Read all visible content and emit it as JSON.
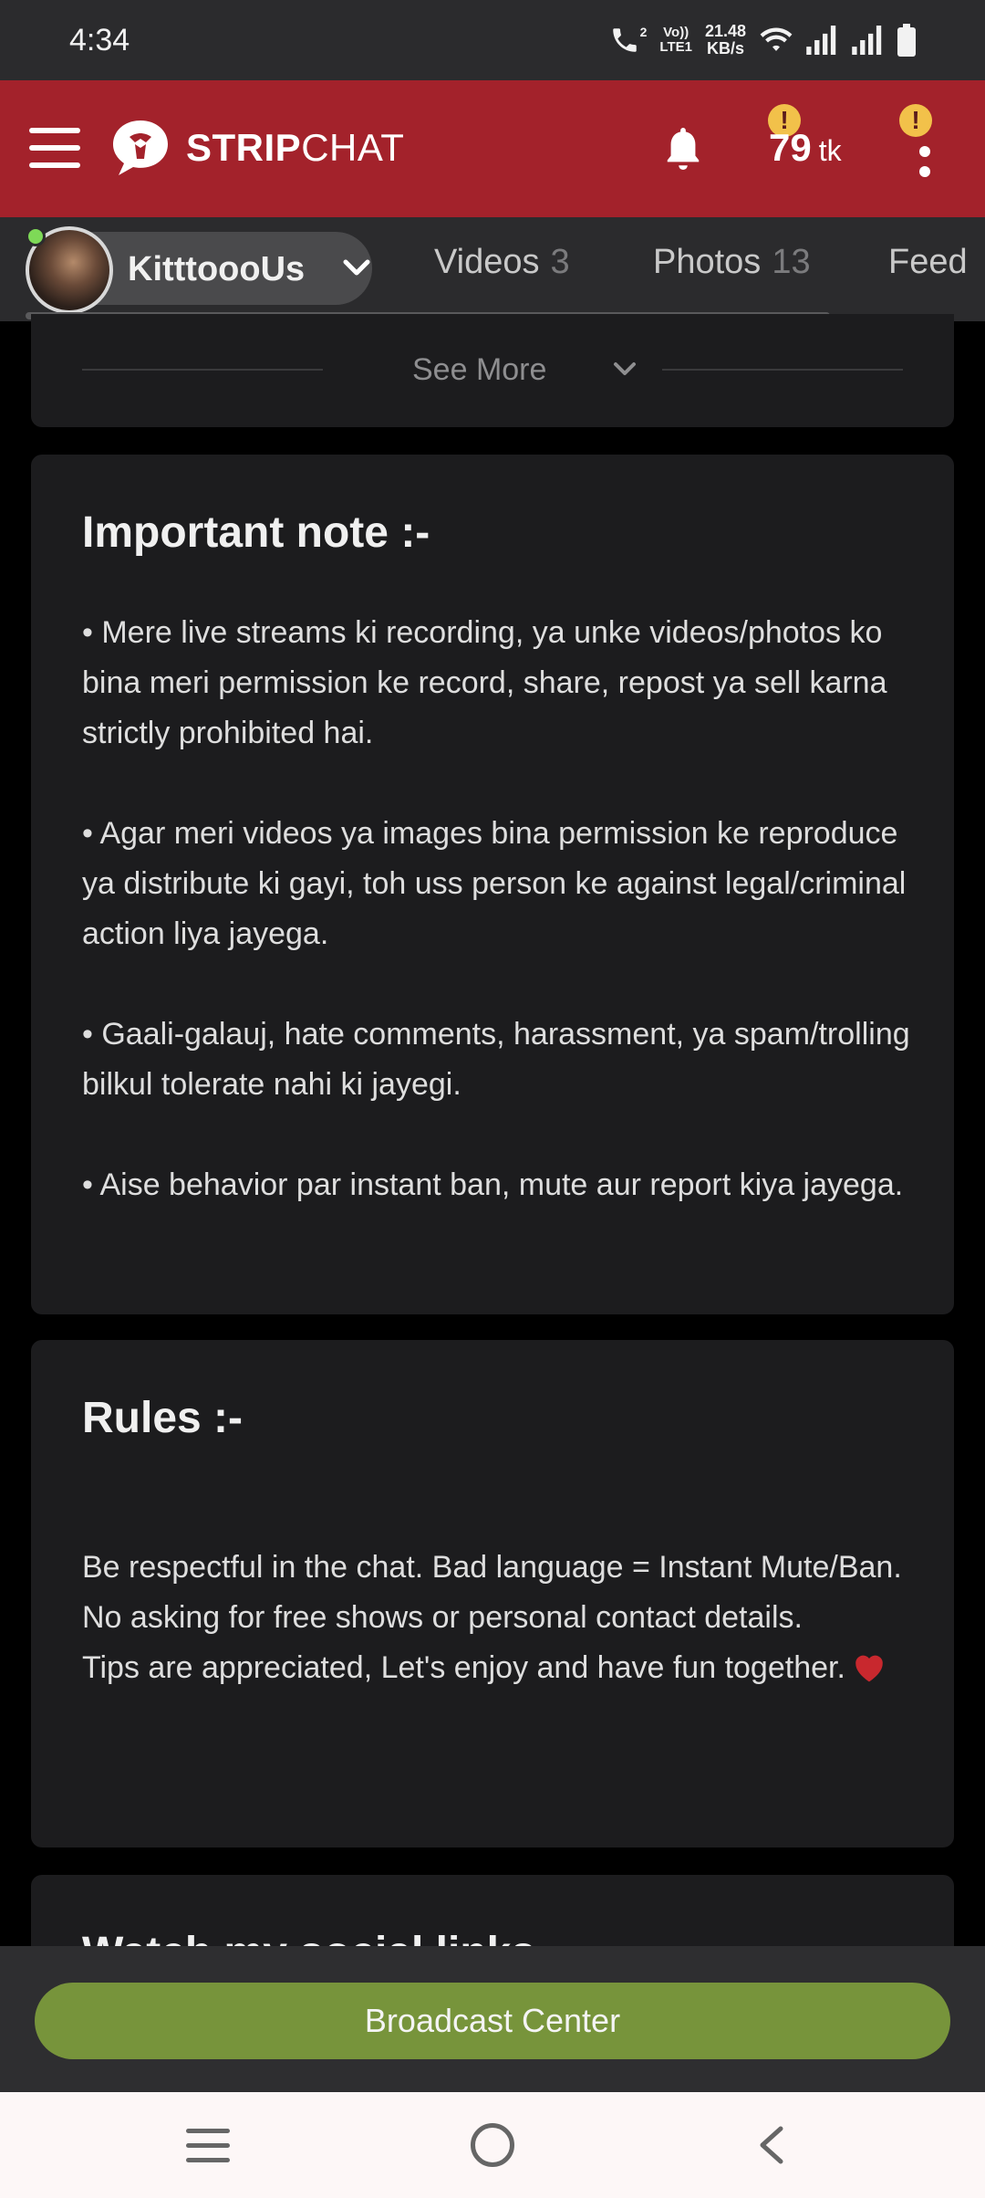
{
  "status_bar": {
    "time": "4:34",
    "call_indicator": "2",
    "network_label_top": "Vo))",
    "network_label_bottom": "LTE1",
    "speed_top": "21.48",
    "speed_bottom": "KB/s"
  },
  "header": {
    "brand_bold": "STRIP",
    "brand_light": "CHAT",
    "token_count": "79",
    "token_unit": "tk",
    "alert_symbol": "!"
  },
  "tabs": {
    "model_name": "KitttoooUs",
    "items": [
      {
        "label": "Videos",
        "count": "3"
      },
      {
        "label": "Photos",
        "count": "13"
      },
      {
        "label": "Feed",
        "count": ""
      }
    ]
  },
  "see_more": {
    "label": "See More"
  },
  "important_note": {
    "title": "Important note :-",
    "paragraphs": [
      "• Mere live streams ki recording, ya unke videos/photos ko bina meri permission ke record, share, repost ya sell karna strictly prohibited hai.",
      "• Agar meri videos ya images bina permission ke reproduce ya distribute ki gayi, toh uss person ke against legal/criminal action liya jayega.",
      "• Gaali-galauj, hate comments, harassment, ya spam/trolling bilkul tolerate nahi ki jayegi.",
      "• Aise behavior par instant ban, mute aur report kiya jayega."
    ]
  },
  "rules": {
    "title": "Rules :-",
    "lines": [
      "Be respectful in the chat. Bad language = Instant Mute/Ban.",
      "No asking for free shows or personal contact details.",
      "Tips are appreciated, Let's enjoy and have fun together."
    ]
  },
  "social": {
    "title": "Watch my social links"
  },
  "broadcast": {
    "label": "Broadcast Center"
  },
  "colors": {
    "header_red": "#a3222b",
    "broadcast_green": "#77943b",
    "alert_yellow": "#f2c14a",
    "online_green": "#7ed957",
    "heart_red": "#c8282e"
  },
  "icons": [
    "menu-icon",
    "stripchat-logo-icon",
    "bell-icon",
    "more-vertical-icon",
    "chevron-down-icon",
    "heart-icon",
    "nav-recents-icon",
    "nav-home-icon",
    "nav-back-icon",
    "wifi-icon",
    "signal-icon",
    "battery-icon",
    "phone-call-icon"
  ]
}
